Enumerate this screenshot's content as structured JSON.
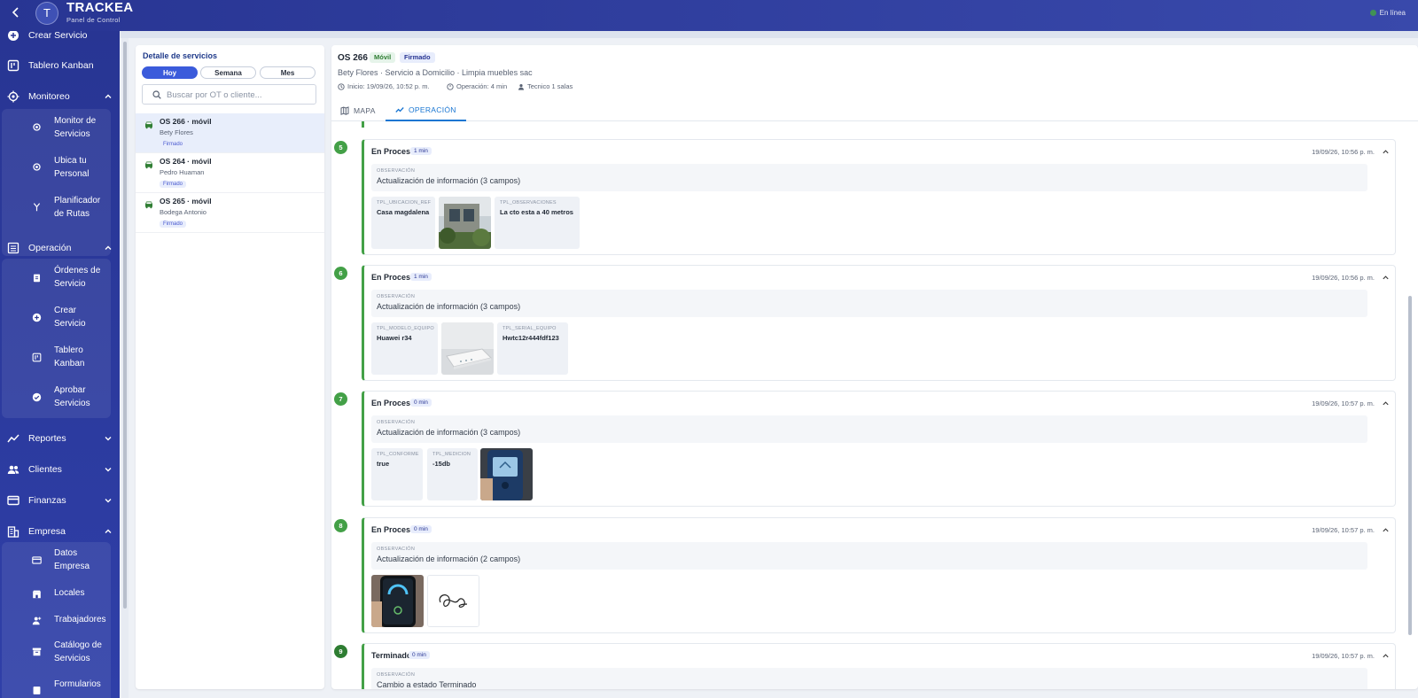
{
  "app": {
    "avatar_initial": "T",
    "title": "TRACKEA",
    "subtitle": "Panel de Control",
    "status": "En línea",
    "colors": {
      "primary": "#283593",
      "accent": "#1976d2",
      "success": "#43a047"
    }
  },
  "sidebar": {
    "items": [
      {
        "label": "Crear Servicio",
        "icon": "add-circle-icon"
      },
      {
        "label": "Tablero Kanban",
        "icon": "kanban-icon"
      },
      {
        "label": "Monitoreo",
        "icon": "target-icon",
        "expanded": true
      },
      {
        "label": "Operación",
        "icon": "list-icon",
        "expanded": true
      },
      {
        "label": "Reportes",
        "icon": "chart-icon",
        "expanded": false
      },
      {
        "label": "Clientes",
        "icon": "people-icon",
        "expanded": false
      },
      {
        "label": "Finanzas",
        "icon": "card-icon",
        "expanded": false
      },
      {
        "label": "Empresa",
        "icon": "building-icon",
        "expanded": true
      }
    ],
    "monitoreo": [
      {
        "label": "Monitor de Servicios",
        "icon": "target-icon"
      },
      {
        "label": "Ubica tu Personal",
        "icon": "target-icon"
      },
      {
        "label": "Planificador de Rutas",
        "icon": "fork-icon"
      }
    ],
    "operacion": [
      {
        "label": "Órdenes de Servicio",
        "icon": "clipboard-icon"
      },
      {
        "label": "Crear Servicio",
        "icon": "add-circle-icon"
      },
      {
        "label": "Tablero Kanban",
        "icon": "kanban-icon"
      },
      {
        "label": "Aprobar Servicios",
        "icon": "check-circle-icon"
      }
    ],
    "empresa": [
      {
        "label": "Datos Empresa",
        "icon": "card-icon"
      },
      {
        "label": "Locales",
        "icon": "store-icon"
      },
      {
        "label": "Trabajadores",
        "icon": "person-icon"
      },
      {
        "label": "Catálogo de Servicios",
        "icon": "archive-icon"
      },
      {
        "label": "Formularios",
        "icon": "form-icon"
      }
    ]
  },
  "list_panel": {
    "title": "Detalle de servicios",
    "filters": [
      "Hoy",
      "Semana",
      "Mes"
    ],
    "active_filter": "Hoy",
    "search_placeholder": "Buscar por OT o cliente...",
    "orders": [
      {
        "title": "OS 266 · móvil",
        "client": "Bety Flores",
        "badge": "Firmado",
        "selected": true
      },
      {
        "title": "OS 264 · móvil",
        "client": "Pedro Huaman",
        "badge": "Firmado",
        "selected": false
      },
      {
        "title": "OS 265 · móvil",
        "client": "Bodega Antonio",
        "badge": "Firmado",
        "selected": false
      }
    ]
  },
  "detail": {
    "title": "OS 266",
    "badges": [
      "Móvil",
      "Firmado"
    ],
    "subtitle": "Bety Flores · Servicio a Domicilio · Limpia muebles sac",
    "meta": [
      "Inicio: 19/09/26, 10:52 p. m.",
      "Operación: 4 min",
      "Tecnico 1 salas"
    ],
    "tabs": [
      "MAPA",
      "OPERACIÓN"
    ],
    "active_tab": "OPERACIÓN",
    "steps": [
      {
        "num": "5",
        "status": "En Proceso",
        "duration": "1 min",
        "timestamp": "19/09/26, 10:56 p. m.",
        "obs_label": "OBSERVACIÓN",
        "obs_text": "Actualización de información (3 campos)",
        "fields": [
          {
            "label": "TPL_UBICACION_REF",
            "value": "Casa magdalena"
          },
          {
            "label": "TPL_OBSERVACIONES",
            "value": "La cto esta a 40 metros"
          }
        ]
      },
      {
        "num": "6",
        "status": "En Proceso",
        "duration": "1 min",
        "timestamp": "19/09/26, 10:56 p. m.",
        "obs_label": "OBSERVACIÓN",
        "obs_text": "Actualización de información (3 campos)",
        "fields": [
          {
            "label": "TPL_MODELO_EQUIPO",
            "value": "Huawei r34"
          },
          {
            "label": "TPL_SERIAL_EQUIPO",
            "value": "Hwtc12r444fdf123"
          }
        ]
      },
      {
        "num": "7",
        "status": "En Proceso",
        "duration": "0 min",
        "timestamp": "19/09/26, 10:57 p. m.",
        "obs_label": "OBSERVACIÓN",
        "obs_text": "Actualización de información (3 campos)",
        "fields": [
          {
            "label": "TPL_CONFORME",
            "value": "true"
          },
          {
            "label": "TPL_MEDICION",
            "value": "-15db"
          }
        ]
      },
      {
        "num": "8",
        "status": "En Proceso",
        "duration": "0 min",
        "timestamp": "19/09/26, 10:57 p. m.",
        "obs_label": "OBSERVACIÓN",
        "obs_text": "Actualización de información (2 campos)",
        "fields": []
      },
      {
        "num": "9",
        "status": "Terminado",
        "duration": "0 min",
        "timestamp": "19/09/26, 10:57 p. m.",
        "obs_label": "OBSERVACIÓN",
        "obs_text": "Cambio a estado Terminado",
        "fields": []
      }
    ]
  }
}
